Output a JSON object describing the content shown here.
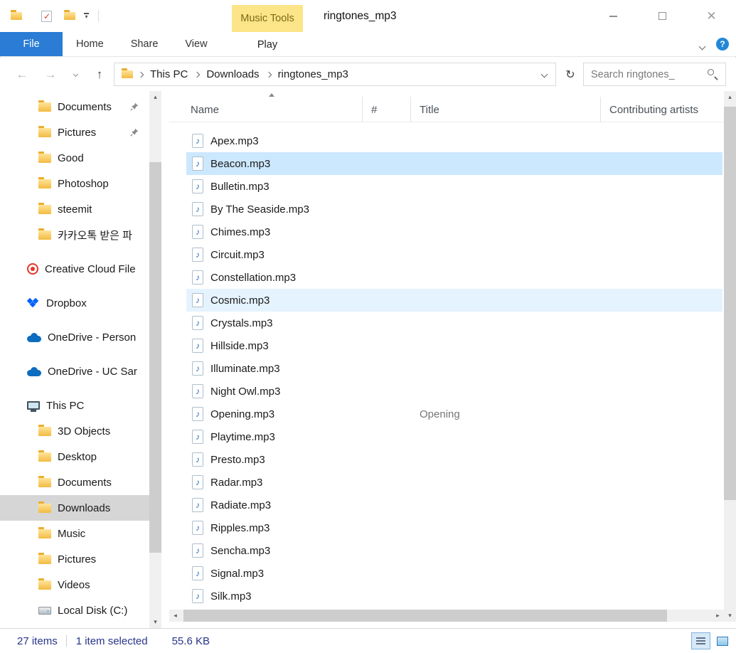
{
  "window": {
    "title": "ringtones_mp3"
  },
  "ribbon": {
    "file_tab": "File",
    "tabs": [
      "Home",
      "Share",
      "View"
    ],
    "contextual_group": "Music Tools",
    "contextual_tab": "Play"
  },
  "address_bar": {
    "breadcrumbs": [
      "This PC",
      "Downloads",
      "ringtones_mp3"
    ],
    "search_text": "Search ringtones_"
  },
  "sidebar": {
    "items": [
      {
        "label": "Documents",
        "icon": "folder",
        "indent": 2,
        "pinned": true
      },
      {
        "label": "Pictures",
        "icon": "folder",
        "indent": 2,
        "pinned": true
      },
      {
        "label": "Good",
        "icon": "folder",
        "indent": 2
      },
      {
        "label": "Photoshop",
        "icon": "folder",
        "indent": 2
      },
      {
        "label": "steemit",
        "icon": "folder",
        "indent": 2
      },
      {
        "label": "카카오톡 받은 파",
        "icon": "folder",
        "indent": 2
      },
      {
        "label": "Creative Cloud File",
        "icon": "creative-cloud",
        "indent": 1,
        "gap": true
      },
      {
        "label": "Dropbox",
        "icon": "dropbox",
        "indent": 1,
        "gap": true
      },
      {
        "label": "OneDrive - Person",
        "icon": "onedrive",
        "indent": 1,
        "gap": true
      },
      {
        "label": "OneDrive - UC Sar",
        "icon": "onedrive",
        "indent": 1,
        "gap": true
      },
      {
        "label": "This PC",
        "icon": "pc",
        "indent": 1,
        "gap": true
      },
      {
        "label": "3D Objects",
        "icon": "folder",
        "indent": 2
      },
      {
        "label": "Desktop",
        "icon": "folder",
        "indent": 2
      },
      {
        "label": "Documents",
        "icon": "folder",
        "indent": 2
      },
      {
        "label": "Downloads",
        "icon": "folder",
        "indent": 2,
        "selected": true
      },
      {
        "label": "Music",
        "icon": "folder",
        "indent": 2
      },
      {
        "label": "Pictures",
        "icon": "folder",
        "indent": 2
      },
      {
        "label": "Videos",
        "icon": "folder",
        "indent": 2
      },
      {
        "label": "Local Disk (C:)",
        "icon": "disk",
        "indent": 2
      }
    ]
  },
  "file_list": {
    "columns": [
      "Name",
      "#",
      "Title",
      "Contributing artists"
    ],
    "sorted_by": "Name",
    "files": [
      {
        "name": "Apex.mp3"
      },
      {
        "name": "Beacon.mp3",
        "state": "selected"
      },
      {
        "name": "Bulletin.mp3"
      },
      {
        "name": "By The Seaside.mp3"
      },
      {
        "name": "Chimes.mp3"
      },
      {
        "name": "Circuit.mp3"
      },
      {
        "name": "Constellation.mp3"
      },
      {
        "name": "Cosmic.mp3",
        "state": "hover"
      },
      {
        "name": "Crystals.mp3"
      },
      {
        "name": "Hillside.mp3"
      },
      {
        "name": "Illuminate.mp3"
      },
      {
        "name": "Night Owl.mp3"
      },
      {
        "name": "Opening.mp3",
        "title": "Opening"
      },
      {
        "name": "Playtime.mp3"
      },
      {
        "name": "Presto.mp3"
      },
      {
        "name": "Radar.mp3"
      },
      {
        "name": "Radiate.mp3"
      },
      {
        "name": "Ripples.mp3"
      },
      {
        "name": "Sencha.mp3"
      },
      {
        "name": "Signal.mp3"
      },
      {
        "name": "Silk.mp3"
      }
    ]
  },
  "status_bar": {
    "items_count": "27 items",
    "selection": "1 item selected",
    "selection_size": "55.6 KB"
  },
  "icons": {
    "note": "♪",
    "close": "✕",
    "back": "←",
    "forward": "→",
    "up": "↑",
    "refresh": "↻",
    "help": "?",
    "check": "✓",
    "tri_up": "▴",
    "tri_down": "▾",
    "tri_left": "◂",
    "tri_right": "▸"
  },
  "colors": {
    "file_tab_blue": "#2a7cd4",
    "contextual_tab_yellow": "#fce488",
    "contextual_tab_text": "#7d6a15",
    "selection_blue": "#cce8ff",
    "hover_blue": "#e5f3ff",
    "sidebar_selected_gray": "#d6d6d6",
    "status_text_blue": "#27348b",
    "help_blue": "#2488d8"
  }
}
